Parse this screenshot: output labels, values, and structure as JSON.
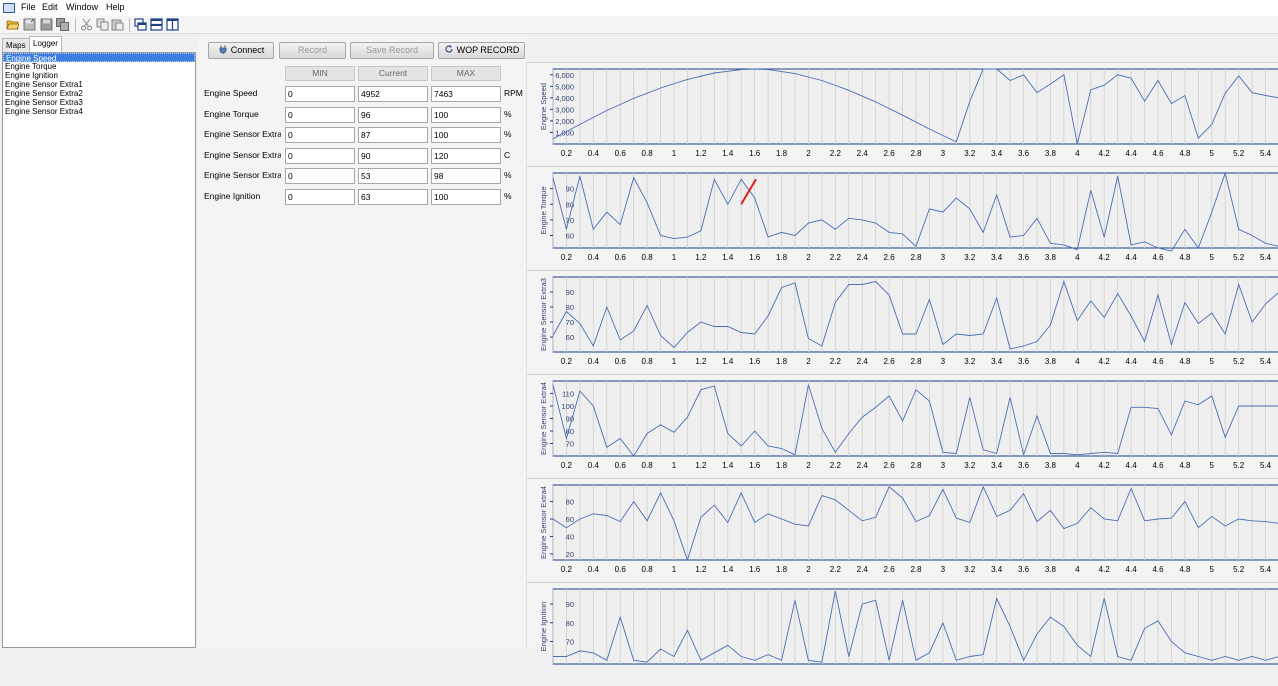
{
  "menu": {
    "file": "File",
    "edit": "Edit",
    "window": "Window",
    "help": "Help"
  },
  "toolbar": {
    "icons": [
      "open-folder-icon",
      "save-icon",
      "save-disabled-icon",
      "save-all-icon",
      "cut-icon",
      "copy-icon",
      "paste-icon",
      "tile-window-icon",
      "horizontal-split-icon",
      "vertical-split-icon"
    ]
  },
  "tabs": {
    "maps": "Maps",
    "logger": "Logger"
  },
  "parameters": [
    "Engine Speed",
    "Engine Torque",
    "Engine Ignition",
    "Engine Sensor Extra1",
    "Engine Sensor Extra2",
    "Engine Sensor Extra3",
    "Engine Sensor Extra4"
  ],
  "buttons": {
    "connect": "Connect",
    "record": "Record",
    "save_record": "Save Record",
    "wop_record": "WOP RECORD"
  },
  "columns": {
    "min": "MIN",
    "current": "Current",
    "max": "MAX"
  },
  "rows": [
    {
      "label": "Engine Speed",
      "min": "0",
      "current": "4952",
      "max": "7463",
      "unit": "RPM"
    },
    {
      "label": "Engine Torque",
      "min": "0",
      "current": "96",
      "max": "100",
      "unit": "%"
    },
    {
      "label": "Engine Sensor Extra",
      "min": "0",
      "current": "87",
      "max": "100",
      "unit": "%"
    },
    {
      "label": "Engine Sensor Extra",
      "min": "0",
      "current": "90",
      "max": "120",
      "unit": "C"
    },
    {
      "label": "Engine Sensor Extra",
      "min": "0",
      "current": "53",
      "max": "98",
      "unit": "%"
    },
    {
      "label": "Engine Ignition",
      "min": "0",
      "current": "63",
      "max": "100",
      "unit": "%"
    }
  ],
  "chart_data": [
    {
      "type": "line",
      "ylabel": "Engine Speed",
      "xlim": [
        0.1,
        5.5
      ],
      "ylim": [
        0,
        6500
      ],
      "yticks": [
        "1,000",
        "2,000",
        "3,000",
        "4,000",
        "5,000",
        "6,000"
      ],
      "ytick_values": [
        1000,
        2000,
        3000,
        4000,
        5000,
        6000
      ],
      "xticks": [
        "0.2",
        "0.4",
        "0.6",
        "0.8",
        "1",
        "1.2",
        "1.4",
        "1.6",
        "1.8",
        "2",
        "2.2",
        "2.4",
        "2.6",
        "2.8",
        "3",
        "3.2",
        "3.4",
        "3.6",
        "3.8",
        "4",
        "4.2",
        "4.4",
        "4.6",
        "4.8",
        "5",
        "5.2",
        "5.4"
      ],
      "series": [
        {
          "color": "#4a6fb5",
          "x": [
            0.1,
            0.3,
            0.5,
            0.7,
            0.9,
            1.1,
            1.3,
            1.5,
            1.6,
            1.7,
            1.9,
            2.1,
            2.3,
            2.5,
            2.7,
            2.9,
            3.1,
            3.2,
            3.3,
            3.4,
            3.5,
            3.6,
            3.7,
            3.8,
            3.9,
            4.0,
            4.1,
            4.2,
            4.3,
            4.4,
            4.5,
            4.6,
            4.7,
            4.8,
            4.9,
            5.0,
            5.1,
            5.2,
            5.3,
            5.4,
            5.5
          ],
          "y": [
            450,
            1700,
            2900,
            3950,
            4850,
            5600,
            6150,
            6450,
            6500,
            6450,
            6100,
            5500,
            4650,
            3650,
            2500,
            1300,
            180,
            3700,
            6500,
            6500,
            5500,
            6000,
            4450,
            5200,
            6000,
            0,
            4700,
            5100,
            6000,
            5700,
            3700,
            5500,
            3500,
            4200,
            500,
            1700,
            4400,
            5900,
            4450,
            4200,
            4000
          ]
        }
      ]
    },
    {
      "type": "line",
      "ylabel": "Engine Torque",
      "xlim": [
        0.1,
        5.5
      ],
      "ylim": [
        52,
        100
      ],
      "yticks": [
        "60",
        "70",
        "80",
        "90"
      ],
      "ytick_values": [
        60,
        70,
        80,
        90
      ],
      "xticks": [
        "0.2",
        "0.4",
        "0.6",
        "0.8",
        "1",
        "1.2",
        "1.4",
        "1.6",
        "1.8",
        "2",
        "2.2",
        "2.4",
        "2.6",
        "2.8",
        "3",
        "3.2",
        "3.4",
        "3.6",
        "3.8",
        "4",
        "4.2",
        "4.4",
        "4.6",
        "4.8",
        "5",
        "5.2",
        "5.4"
      ],
      "series": [
        {
          "color": "#4a6fb5",
          "x": [
            0.1,
            0.2,
            0.3,
            0.4,
            0.5,
            0.6,
            0.7,
            0.8,
            0.9,
            1.0,
            1.1,
            1.2,
            1.3,
            1.4,
            1.5,
            1.6,
            1.7,
            1.8,
            1.9,
            2.0,
            2.1,
            2.2,
            2.3,
            2.4,
            2.5,
            2.6,
            2.7,
            2.8,
            2.9,
            3.0,
            3.1,
            3.2,
            3.3,
            3.4,
            3.5,
            3.6,
            3.7,
            3.8,
            3.9,
            4.0,
            4.1,
            4.2,
            4.3,
            4.4,
            4.5,
            4.6,
            4.7,
            4.8,
            4.9,
            5.0,
            5.1,
            5.2,
            5.3,
            5.4,
            5.5
          ],
          "y": [
            97,
            64,
            98,
            64,
            75,
            67,
            97,
            81,
            60,
            58,
            59,
            63,
            96,
            80,
            96,
            84,
            59,
            62,
            60,
            68,
            70,
            64,
            71,
            70,
            68,
            62,
            61,
            53,
            77,
            75,
            84,
            77,
            62,
            86,
            59,
            60,
            71,
            55,
            54,
            51,
            89,
            59,
            98,
            54,
            56,
            52,
            50,
            64,
            52,
            75,
            100,
            64,
            60,
            55,
            53
          ]
        },
        {
          "color": "#e02020",
          "x": [
            1.5,
            1.61
          ],
          "y": [
            80,
            96
          ]
        }
      ]
    },
    {
      "type": "line",
      "ylabel": "Engine Sensor Extra3",
      "xlim": [
        0.1,
        5.5
      ],
      "ylim": [
        50,
        100
      ],
      "yticks": [
        "60",
        "70",
        "80",
        "90"
      ],
      "ytick_values": [
        60,
        70,
        80,
        90
      ],
      "xticks": [
        "0.2",
        "0.4",
        "0.6",
        "0.8",
        "1",
        "1.2",
        "1.4",
        "1.6",
        "1.8",
        "2",
        "2.2",
        "2.4",
        "2.6",
        "2.8",
        "3",
        "3.2",
        "3.4",
        "3.6",
        "3.8",
        "4",
        "4.2",
        "4.4",
        "4.6",
        "4.8",
        "5",
        "5.2",
        "5.4"
      ],
      "series": [
        {
          "color": "#4a6fb5",
          "x": [
            0.1,
            0.2,
            0.3,
            0.4,
            0.5,
            0.6,
            0.7,
            0.8,
            0.9,
            1.0,
            1.1,
            1.2,
            1.3,
            1.4,
            1.5,
            1.6,
            1.7,
            1.8,
            1.9,
            2.0,
            2.1,
            2.2,
            2.3,
            2.4,
            2.5,
            2.6,
            2.7,
            2.8,
            2.9,
            3.0,
            3.1,
            3.2,
            3.3,
            3.4,
            3.5,
            3.6,
            3.7,
            3.8,
            3.9,
            4.0,
            4.1,
            4.2,
            4.3,
            4.4,
            4.5,
            4.6,
            4.7,
            4.8,
            4.9,
            5.0,
            5.1,
            5.2,
            5.3,
            5.4,
            5.5
          ],
          "y": [
            61,
            77,
            69,
            54,
            80,
            58,
            64,
            81,
            61,
            53,
            63,
            70,
            67,
            67,
            63,
            62,
            74,
            93,
            96,
            59,
            54,
            83,
            95,
            95,
            97,
            88,
            62,
            62,
            85,
            55,
            62,
            61,
            62,
            86,
            52,
            54,
            57,
            68,
            97,
            71,
            84,
            73,
            89,
            74,
            57,
            88,
            55,
            83,
            69,
            76,
            62,
            95,
            70,
            82,
            90
          ]
        }
      ]
    },
    {
      "type": "line",
      "ylabel": "Engine Sensor Extra4",
      "xlim": [
        0.1,
        5.5
      ],
      "ylim": [
        60,
        120
      ],
      "yticks": [
        "70",
        "80",
        "90",
        "100",
        "110"
      ],
      "ytick_values": [
        70,
        80,
        90,
        100,
        110
      ],
      "xticks": [
        "0.2",
        "0.4",
        "0.6",
        "0.8",
        "1",
        "1.2",
        "1.4",
        "1.6",
        "1.8",
        "2",
        "2.2",
        "2.4",
        "2.6",
        "2.8",
        "3",
        "3.2",
        "3.4",
        "3.6",
        "3.8",
        "4",
        "4.2",
        "4.4",
        "4.6",
        "4.8",
        "5",
        "5.2",
        "5.4"
      ],
      "series": [
        {
          "color": "#4a6fb5",
          "x": [
            0.1,
            0.2,
            0.3,
            0.4,
            0.5,
            0.6,
            0.7,
            0.8,
            0.9,
            1.0,
            1.1,
            1.2,
            1.3,
            1.4,
            1.5,
            1.6,
            1.7,
            1.8,
            1.9,
            2.0,
            2.1,
            2.2,
            2.3,
            2.4,
            2.5,
            2.6,
            2.7,
            2.8,
            2.9,
            3.0,
            3.1,
            3.2,
            3.3,
            3.4,
            3.5,
            3.6,
            3.7,
            3.8,
            3.9,
            4.0,
            4.1,
            4.2,
            4.3,
            4.4,
            4.5,
            4.6,
            4.7,
            4.8,
            4.9,
            5.0,
            5.1,
            5.2,
            5.3,
            5.4,
            5.5
          ],
          "y": [
            117,
            74,
            112,
            100,
            67,
            74,
            60,
            78,
            85,
            79,
            91,
            113,
            116,
            78,
            68,
            80,
            68,
            66,
            61,
            117,
            82,
            63,
            78,
            91,
            99,
            108,
            88,
            113,
            104,
            63,
            62,
            107,
            65,
            62,
            107,
            61,
            92,
            62,
            62,
            61,
            62,
            63,
            62,
            99,
            99,
            98,
            77,
            104,
            101,
            108,
            75,
            100,
            100,
            100,
            100
          ]
        }
      ]
    },
    {
      "type": "line",
      "ylabel": "Engine Sensor Extra4",
      "xlim": [
        0.1,
        5.5
      ],
      "ylim": [
        13,
        99
      ],
      "yticks": [
        "20",
        "40",
        "60",
        "80"
      ],
      "ytick_values": [
        20,
        40,
        60,
        80
      ],
      "xticks": [
        "0.2",
        "0.4",
        "0.6",
        "0.8",
        "1",
        "1.2",
        "1.4",
        "1.6",
        "1.8",
        "2",
        "2.2",
        "2.4",
        "2.6",
        "2.8",
        "3",
        "3.2",
        "3.4",
        "3.6",
        "3.8",
        "4",
        "4.2",
        "4.4",
        "4.6",
        "4.8",
        "5",
        "5.2",
        "5.4"
      ],
      "series": [
        {
          "color": "#4a6fb5",
          "x": [
            0.1,
            0.2,
            0.3,
            0.4,
            0.5,
            0.6,
            0.7,
            0.8,
            0.9,
            1.0,
            1.1,
            1.2,
            1.3,
            1.4,
            1.5,
            1.6,
            1.7,
            1.8,
            1.9,
            2.0,
            2.1,
            2.2,
            2.3,
            2.4,
            2.5,
            2.6,
            2.7,
            2.8,
            2.9,
            3.0,
            3.1,
            3.2,
            3.3,
            3.4,
            3.5,
            3.6,
            3.7,
            3.8,
            3.9,
            4.0,
            4.1,
            4.2,
            4.3,
            4.4,
            4.5,
            4.6,
            4.7,
            4.8,
            4.9,
            5.0,
            5.1,
            5.2,
            5.3,
            5.4,
            5.5
          ],
          "y": [
            60,
            50,
            60,
            66,
            64,
            57,
            80,
            58,
            90,
            58,
            13,
            62,
            76,
            56,
            90,
            56,
            66,
            60,
            54,
            52,
            87,
            82,
            70,
            58,
            62,
            97,
            84,
            57,
            64,
            94,
            61,
            56,
            97,
            63,
            70,
            89,
            57,
            70,
            49,
            55,
            73,
            60,
            58,
            95,
            58,
            60,
            61,
            80,
            50,
            63,
            52,
            60,
            58,
            57,
            55
          ]
        }
      ]
    },
    {
      "type": "line",
      "ylabel": "Engine Ignition",
      "xlim": [
        0.1,
        5.5
      ],
      "ylim": [
        58,
        98
      ],
      "yticks": [
        "70",
        "80",
        "90"
      ],
      "ytick_values": [
        70,
        80,
        90
      ],
      "series": [
        {
          "color": "#4a6fb5",
          "x": [
            0.1,
            0.2,
            0.3,
            0.4,
            0.5,
            0.6,
            0.7,
            0.8,
            0.9,
            1.0,
            1.1,
            1.2,
            1.3,
            1.4,
            1.5,
            1.6,
            1.7,
            1.8,
            1.9,
            2.0,
            2.1,
            2.2,
            2.3,
            2.4,
            2.5,
            2.6,
            2.7,
            2.8,
            2.9,
            3.0,
            3.1,
            3.2,
            3.3,
            3.4,
            3.5,
            3.6,
            3.7,
            3.8,
            3.9,
            4.0,
            4.1,
            4.2,
            4.3,
            4.4,
            4.5,
            4.6,
            4.7,
            4.8,
            4.9,
            5.0,
            5.1,
            5.2,
            5.3,
            5.4,
            5.5
          ],
          "y": [
            62,
            62,
            65,
            64,
            60,
            83,
            60,
            59,
            66,
            62,
            76,
            60,
            64,
            68,
            62,
            60,
            63,
            60,
            92,
            60,
            59,
            97,
            62,
            90,
            92,
            60,
            92,
            60,
            64,
            80,
            60,
            62,
            63,
            93,
            78,
            60,
            74,
            83,
            78,
            68,
            62,
            93,
            62,
            60,
            77,
            81,
            70,
            64,
            62,
            60,
            62,
            60,
            62,
            60,
            62
          ]
        }
      ]
    }
  ]
}
